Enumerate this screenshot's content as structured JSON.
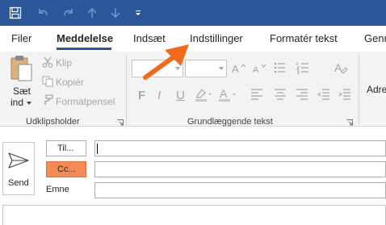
{
  "quick_access": {
    "icons": [
      "save-icon",
      "undo-icon",
      "redo-icon",
      "arrow-up-icon",
      "arrow-down-icon",
      "customize-qat-icon"
    ]
  },
  "tabs": [
    {
      "label": "Filer",
      "active": false
    },
    {
      "label": "Meddelelse",
      "active": true
    },
    {
      "label": "Indsæt",
      "active": false
    },
    {
      "label": "Indstillinger",
      "active": false
    },
    {
      "label": "Formatér tekst",
      "active": false
    },
    {
      "label": "Genn",
      "active": false
    }
  ],
  "clipboard": {
    "paste_label_1": "Sæt",
    "paste_label_2": "ind",
    "cut_label": "Klip",
    "copy_label": "Kopiér",
    "format_painter_label": "Formatpensel",
    "group_label": "Udklipsholder"
  },
  "basic_text": {
    "bold_glyph": "F",
    "italic_glyph": "I",
    "underline_glyph": "U",
    "group_label": "Grundlæggende tekst"
  },
  "names": {
    "partial_label": "Adre"
  },
  "compose": {
    "send_label": "Send",
    "to_button_label": "Til...",
    "cc_button_label": "Cc...",
    "subject_label": "Emne",
    "to_value": "",
    "cc_value": "",
    "subject_value": ""
  },
  "colors": {
    "titlebar": "#2b579a",
    "ribbon_bg": "#f3f3f3",
    "annotation_arrow": "#f26b1d",
    "cc_highlight": "#f48b56"
  }
}
